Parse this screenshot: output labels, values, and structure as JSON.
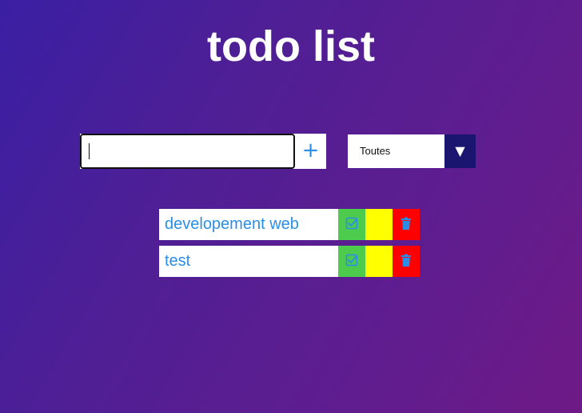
{
  "app": {
    "title": "todo list"
  },
  "form": {
    "input_value": "",
    "add_icon": "plus-icon",
    "add_glyph": "+"
  },
  "filter": {
    "selected": "Toutes",
    "arrow_glyph": "▼",
    "arrow_icon": "caret-down-icon"
  },
  "todos": [
    {
      "text": "developement web",
      "complete_icon": "checkbox-check-icon",
      "delete_icon": "trash-icon"
    },
    {
      "text": "test",
      "complete_icon": "checkbox-check-icon",
      "delete_icon": "trash-icon"
    }
  ],
  "colors": {
    "accent": "#2a8ee8",
    "complete_button": "#4ccb4c",
    "edit_button": "#ffff00",
    "delete_button": "#ff0000",
    "filter_arrow_bg": "#1a1670"
  }
}
